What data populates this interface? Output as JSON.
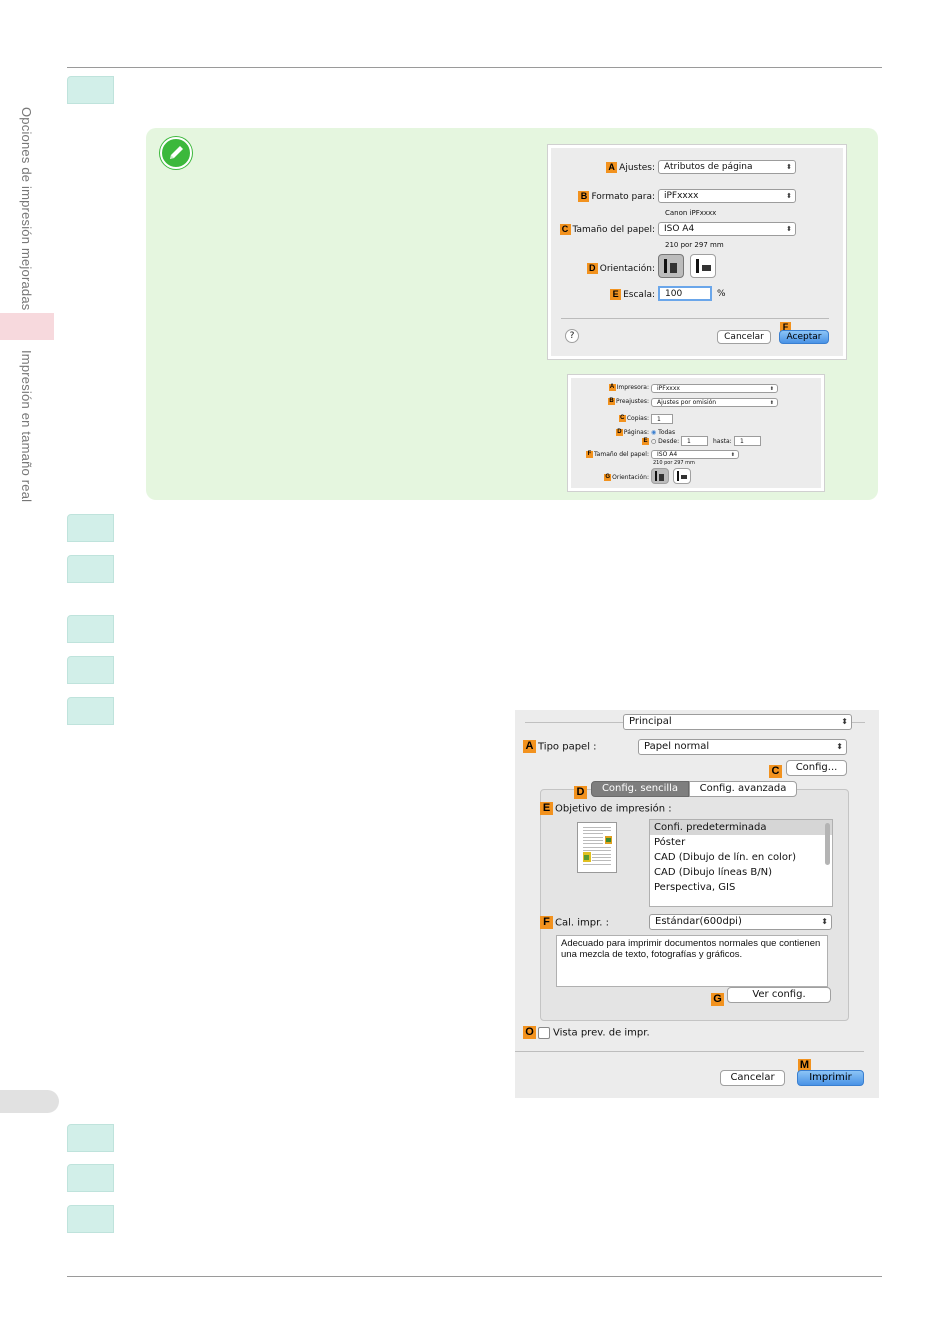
{
  "sidebar": {
    "upper_text": "Opciones de impresión mejoradas",
    "lower_text": "Impresión en tamaño real"
  },
  "dialog_page_setup": {
    "ajustes_label": "Ajustes:",
    "ajustes_value": "Atributos de página",
    "formato_label": "Formato para:",
    "formato_value": "iPFxxxx",
    "formato_sub": "Canon iPFxxxx",
    "tamano_label": "Tamaño del papel:",
    "tamano_value": "ISO A4",
    "tamano_sub": "210 por 297 mm",
    "orientacion_label": "Orientación:",
    "escala_label": "Escala:",
    "escala_value": "100",
    "escala_unit": "%",
    "help": "?",
    "cancel": "Cancelar",
    "accept": "Aceptar",
    "badges": [
      "A",
      "B",
      "C",
      "D",
      "E",
      "F"
    ]
  },
  "dialog_print_small": {
    "impresora_label": "Impresora:",
    "impresora_value": "iPFxxxx",
    "preajustes_label": "Preajustes:",
    "preajustes_value": "Ajustes por omisión",
    "copias_label": "Copias:",
    "copias_value": "1",
    "paginas_label": "Páginas:",
    "todas": "Todas",
    "desde": "Desde:",
    "desde_value": "1",
    "hasta": "hasta:",
    "hasta_value": "1",
    "tamano_label": "Tamaño del papel:",
    "tamano_value": "ISO A4",
    "tamano_sub": "210 por 297 mm",
    "orientacion_label": "Orientación:",
    "badges": [
      "A",
      "B",
      "C",
      "D",
      "E",
      "F",
      "G"
    ]
  },
  "dialog_principal": {
    "panel": "Principal",
    "tipo_label": "Tipo papel :",
    "tipo_value": "Papel normal",
    "config_button": "Config...",
    "tab_simple": "Config. sencilla",
    "tab_advanced": "Config. avanzada",
    "objetivo_label": "Objetivo de impresión :",
    "objetivo_items": [
      "Confi. predeterminada",
      "Póster",
      "CAD (Dibujo de lín. en color)",
      "CAD (Dibujo líneas B/N)",
      "Perspectiva, GIS"
    ],
    "cal_label": "Cal. impr. :",
    "cal_value": "Estándar(600dpi)",
    "description": "Adecuado para imprimir documentos normales que contienen una mezcla de texto, fotografías y gráficos.",
    "ver_config": "Ver config.",
    "preview_label": "Vista prev. de impr.",
    "cancel": "Cancelar",
    "print": "Imprimir",
    "badges": [
      "A",
      "C",
      "D",
      "E",
      "F",
      "G",
      "O",
      "M"
    ]
  }
}
